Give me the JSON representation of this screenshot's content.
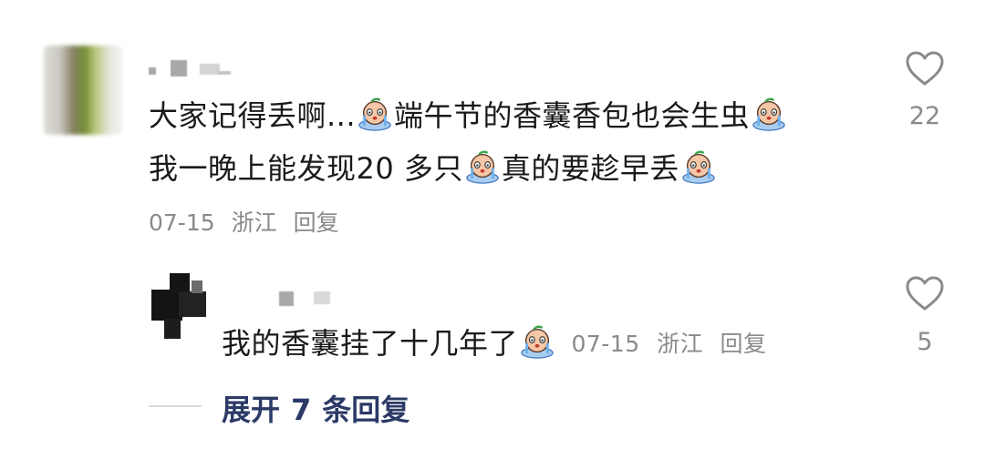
{
  "comment": {
    "segments": [
      "大家记得丢啊...",
      "端午节的香囊香包也会生虫"
    ],
    "segments2": [
      "我一晚上能发现20 多只",
      "真的要趁早丢"
    ],
    "date": "07-15",
    "location": "浙江",
    "reply_label": "回复",
    "like_count": "22"
  },
  "reply": {
    "text": "我的香囊挂了十几年了",
    "date": "07-15",
    "location": "浙江",
    "reply_label": "回复",
    "like_count": "5"
  },
  "expand": {
    "label_pre": "展开",
    "count": "7",
    "label_post": "条回复"
  },
  "icons": [
    "heart-outline-icon",
    "crying-emoji-icon"
  ],
  "colors": {
    "text": "#1a1a1a",
    "meta": "#8a8a8a",
    "expand": "#2b3a66",
    "heart": "#8a8a8a"
  }
}
